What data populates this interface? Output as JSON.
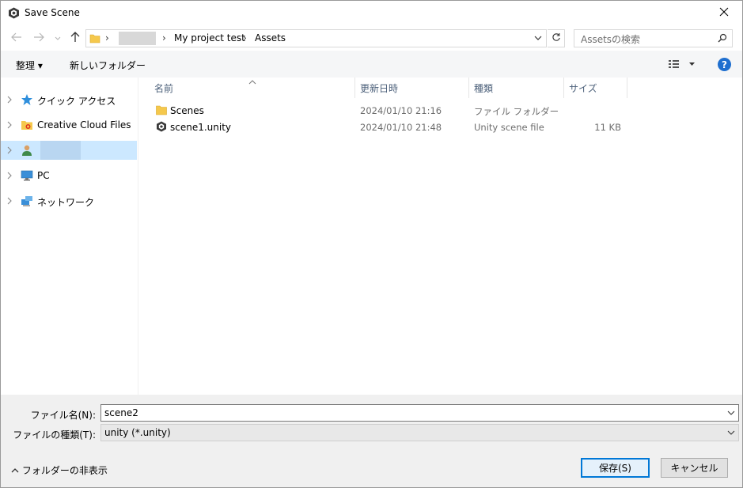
{
  "window": {
    "title": "Save Scene"
  },
  "address": {
    "crumbs": [
      "My project test",
      "Assets"
    ],
    "search_placeholder": "Assetsの検索"
  },
  "toolbar": {
    "organize_label": "整理 ▾",
    "new_folder_label": "新しいフォルダー",
    "help_label": "?"
  },
  "sidebar": {
    "items": [
      {
        "label": "クイック アクセス"
      },
      {
        "label": "Creative Cloud Files"
      },
      {
        "label": ""
      },
      {
        "label": "PC"
      },
      {
        "label": "ネットワーク"
      }
    ]
  },
  "filelist": {
    "columns": [
      "名前",
      "更新日時",
      "種類",
      "サイズ"
    ],
    "rows": [
      {
        "name": "Scenes",
        "date": "2024/01/10 21:16",
        "type": "ファイル フォルダー",
        "size": ""
      },
      {
        "name": "scene1.unity",
        "date": "2024/01/10 21:48",
        "type": "Unity scene file",
        "size": "11 KB"
      }
    ]
  },
  "bottom": {
    "filename_label": "ファイル名(N):",
    "filename_value": "scene2",
    "filetype_label": "ファイルの種類(T):",
    "filetype_value": "unity (*.unity)",
    "hide_folders_label": "フォルダーの非表示",
    "save_label": "保存(S)",
    "cancel_label": "キャンセル"
  },
  "colors": {
    "accent": "#0078d7",
    "selection": "#cce8ff",
    "folder": "#f5c84c"
  },
  "icons": [
    "unity-icon",
    "close-icon",
    "back-arrow-icon",
    "forward-arrow-icon",
    "up-arrow-icon",
    "folder-icon",
    "refresh-icon",
    "search-icon",
    "view-icon",
    "help-icon",
    "star-icon",
    "creative-cloud-icon",
    "user-icon",
    "pc-icon",
    "network-icon"
  ]
}
